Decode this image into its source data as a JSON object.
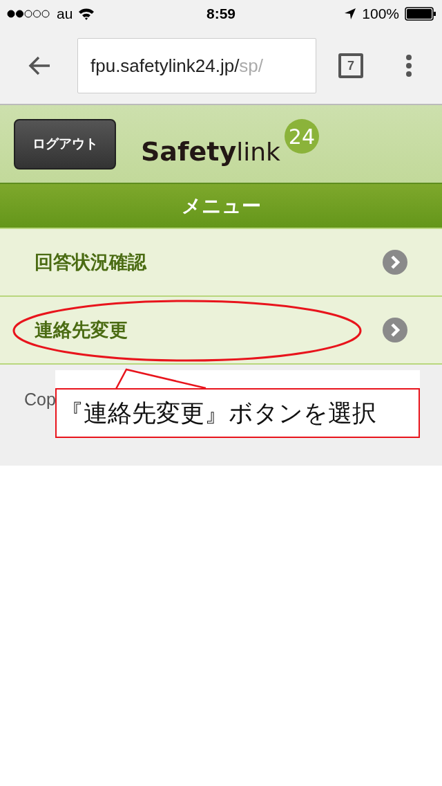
{
  "status_bar": {
    "carrier": "au",
    "time": "8:59",
    "battery": "100%"
  },
  "browser": {
    "url_host": "fpu.safetylink24.jp/",
    "url_path": "sp/",
    "tab_count": "7"
  },
  "header": {
    "logout": "ログアウト",
    "logo": {
      "bold": "Safety",
      "light": "link",
      "badge": "24"
    }
  },
  "menu": {
    "title": "メニュー",
    "items": [
      {
        "label": "回答状況確認",
        "highlighted": false
      },
      {
        "label": "連絡先変更",
        "highlighted": true
      }
    ]
  },
  "footer": {
    "text": "Cop"
  },
  "callout": {
    "text": "『連絡先変更』ボタンを選択"
  }
}
